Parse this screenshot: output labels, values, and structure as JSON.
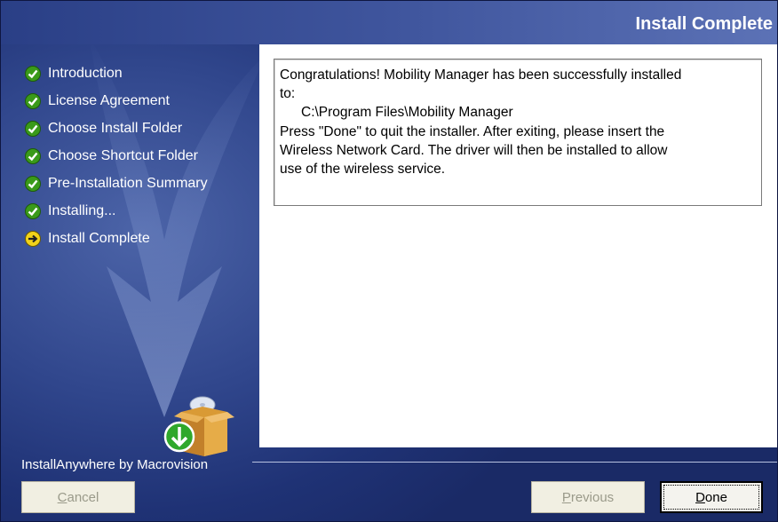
{
  "window": {
    "title": "Install Complete"
  },
  "steps": [
    {
      "label": "Introduction",
      "state": "done",
      "icon": "check-icon"
    },
    {
      "label": "License Agreement",
      "state": "done",
      "icon": "check-icon"
    },
    {
      "label": "Choose Install Folder",
      "state": "done",
      "icon": "check-icon"
    },
    {
      "label": "Choose Shortcut Folder",
      "state": "done",
      "icon": "check-icon"
    },
    {
      "label": "Pre-Installation Summary",
      "state": "done",
      "icon": "check-icon"
    },
    {
      "label": "Installing...",
      "state": "done",
      "icon": "check-icon"
    },
    {
      "label": "Install Complete",
      "state": "current",
      "icon": "arrow-right-icon"
    }
  ],
  "message": {
    "lines": [
      "Congratulations! Mobility Manager has been successfully installed",
      "to:",
      "    C:\\Program Files\\Mobility Manager",
      "Press \"Done\" to quit the installer. After exiting,  please insert the",
      "Wireless Network Card. The driver will then be installed to allow",
      "use of the wireless service."
    ]
  },
  "footer": {
    "brand": "InstallAnywhere by Macrovision",
    "cancel": {
      "label_first": "C",
      "label_rest": "ancel",
      "enabled": false
    },
    "previous": {
      "label_first": "P",
      "label_rest": "revious",
      "enabled": false
    },
    "done": {
      "label_first": "D",
      "label_rest": "one",
      "enabled": true
    }
  },
  "colors": {
    "check_green": "#3a9a1a",
    "current_yellow": "#f2d21a",
    "title_bg": "#41579f"
  }
}
